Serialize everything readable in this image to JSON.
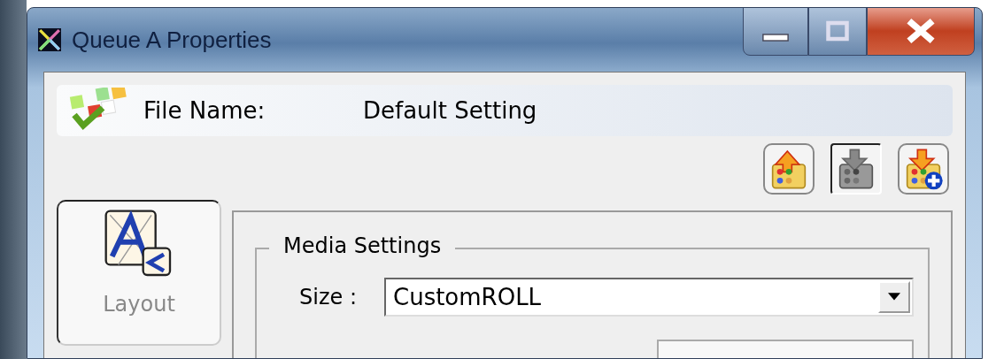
{
  "window": {
    "title": "Queue A Properties"
  },
  "header": {
    "label": "File Name:",
    "value": "Default Setting"
  },
  "toolbar": [
    {
      "kind": "export",
      "disabled": false
    },
    {
      "kind": "import",
      "disabled": true
    },
    {
      "kind": "add",
      "disabled": false
    }
  ],
  "sidebar": {
    "items": [
      {
        "label": "Layout",
        "selected": true
      }
    ]
  },
  "media_settings": {
    "title": "Media Settings",
    "size_label": "Size :",
    "size_value": "CustomROLL"
  }
}
